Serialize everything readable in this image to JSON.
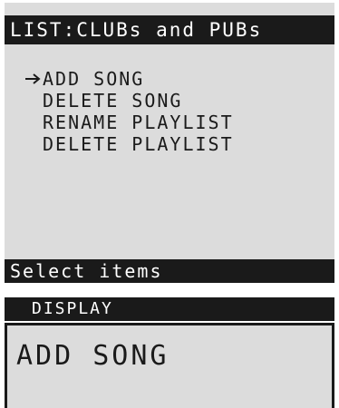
{
  "panel": {
    "title": "LIST:CLUBs and PUBs",
    "menu": [
      {
        "label": "ADD SONG",
        "selected": true
      },
      {
        "label": "DELETE SONG",
        "selected": false
      },
      {
        "label": "RENAME PLAYLIST",
        "selected": false
      },
      {
        "label": "DELETE PLAYLIST",
        "selected": false
      }
    ],
    "cursor_icon": "arrow-right-icon",
    "status": "Select items"
  },
  "display": {
    "header": "DISPLAY",
    "text": "ADD SONG"
  },
  "colors": {
    "screen_bg": "#dcdcdc",
    "bar_bg": "#1a1a1a",
    "bar_text": "#ffffff",
    "text": "#1a1a1a"
  }
}
